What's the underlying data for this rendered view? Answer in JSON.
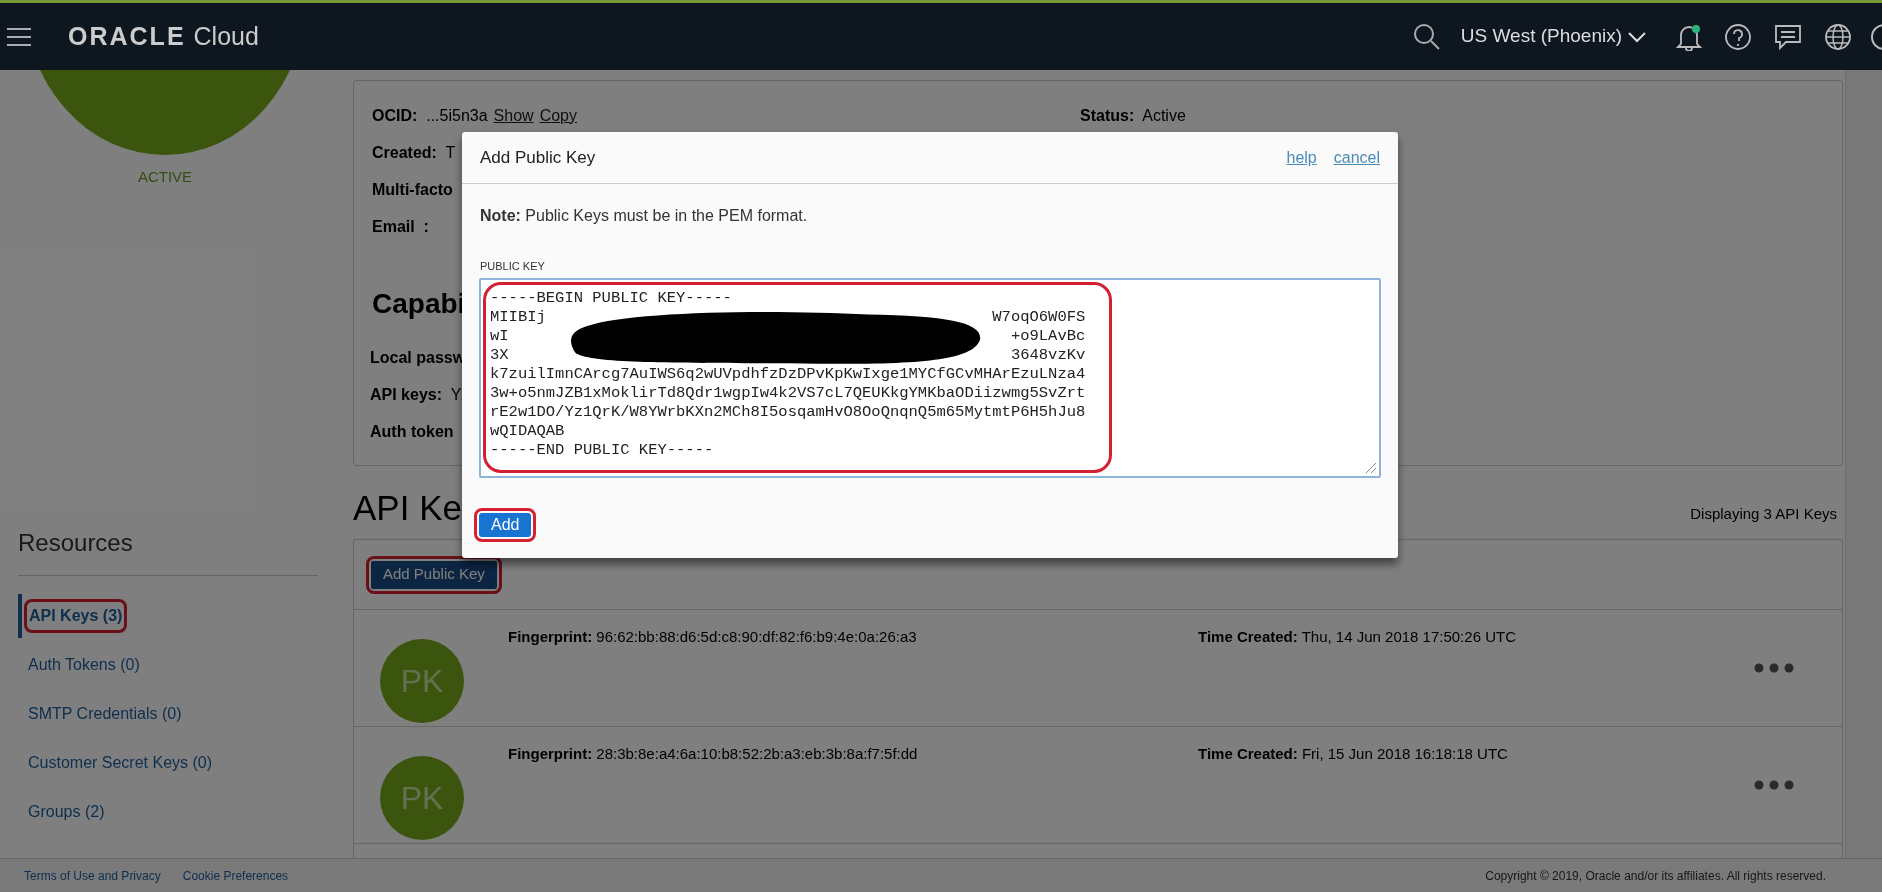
{
  "header": {
    "brand": "ORACLE",
    "product": "Cloud",
    "region": "US West (Phoenix)",
    "has_unread": true
  },
  "profile": {
    "status": "ACTIVE"
  },
  "details": {
    "fields": [
      {
        "text": "**OCID:**  ...5i5n3a",
        "links": [
          "Show",
          "Copy"
        ]
      },
      {
        "text": "**Created:**  T"
      },
      {
        "text": "**Multi-facto**"
      },
      {
        "text": "**Email  :**"
      }
    ],
    "status": "**Status:**  Active",
    "capabilities": {
      "heading": "Capabi",
      "fields": [
        "**Local passw**",
        "**API keys:**  Y",
        "**Auth token**"
      ]
    }
  },
  "resources": {
    "heading": "Resources",
    "items": [
      {
        "label": "API Keys (3)",
        "selected": true,
        "highlighted": true
      },
      {
        "label": "Auth Tokens (0)",
        "selected": false,
        "highlighted": false
      },
      {
        "label": "SMTP Credentials (0)",
        "selected": false,
        "highlighted": false
      },
      {
        "label": "Customer Secret Keys (0)",
        "selected": false,
        "highlighted": false
      },
      {
        "label": "Groups (2)",
        "selected": false,
        "highlighted": false
      }
    ]
  },
  "api_keys": {
    "heading": "API Ke",
    "count_text": "Displaying 3 API Keys",
    "add_button": {
      "label": "Add Public Key",
      "highlighted": true
    },
    "rows": [
      {
        "avatar": "PK",
        "fingerprint": "**Fingerprint:** 96:62:bb:88:d6:5d:c8:90:df:82:f6:b9:4e:0a:26:a3",
        "time": "**Time Created:** Thu, 14 Jun 2018 17:50:26 UTC"
      },
      {
        "avatar": "PK",
        "fingerprint": "**Fingerprint:** 28:3b:8e:a4:6a:10:b8:52:2b:a3:eb:3b:8a:f7:5f:dd",
        "time": "**Time Created:** Fri, 15 Jun 2018 16:18:18 UTC"
      }
    ]
  },
  "dialog": {
    "title": "Add Public Key",
    "links": [
      "help",
      "cancel"
    ],
    "note": "**Note:** Public Keys must be in the PEM format.",
    "field_label": "PUBLIC KEY",
    "field_highlighted": true,
    "key_lines": [
      {
        "left": "-----BEGIN PUBLIC KEY-----"
      },
      {
        "left": "MIIBIj",
        "right": "W7oqO6W0FS"
      },
      {
        "left": "wI",
        "right": "+o9LAvBc"
      },
      {
        "left": "3X",
        "right": "3648vzKv"
      },
      {
        "left": "k7zuilImnCArcg7AuIWS6q2wUVpdhfzDzDPvKpKwIxge1MYCfGCvMHArEzuLNza4"
      },
      {
        "left": "3w+o5nmJZB1xMoklirTd8Qdr1wgpIw4k2VS7cL7QEUKkgYMKbaODiizwmg5SvZrt"
      },
      {
        "left": "rE2w1DO/Yz1QrK/W8YWrbKXn2MCh8I5osqamHvO8OoQnqnQ5m65MytmtP6H5hJu8"
      },
      {
        "left": "wQIDAQAB"
      },
      {
        "left": "-----END PUBLIC KEY-----"
      }
    ],
    "add_button": {
      "label": "Add",
      "highlighted": true
    }
  },
  "footer": {
    "links": [
      "Terms of Use and Privacy",
      "Cookie Preferences"
    ],
    "copyright": "Copyright © 2019, Oracle and/or its affiliates. All rights reserved."
  }
}
